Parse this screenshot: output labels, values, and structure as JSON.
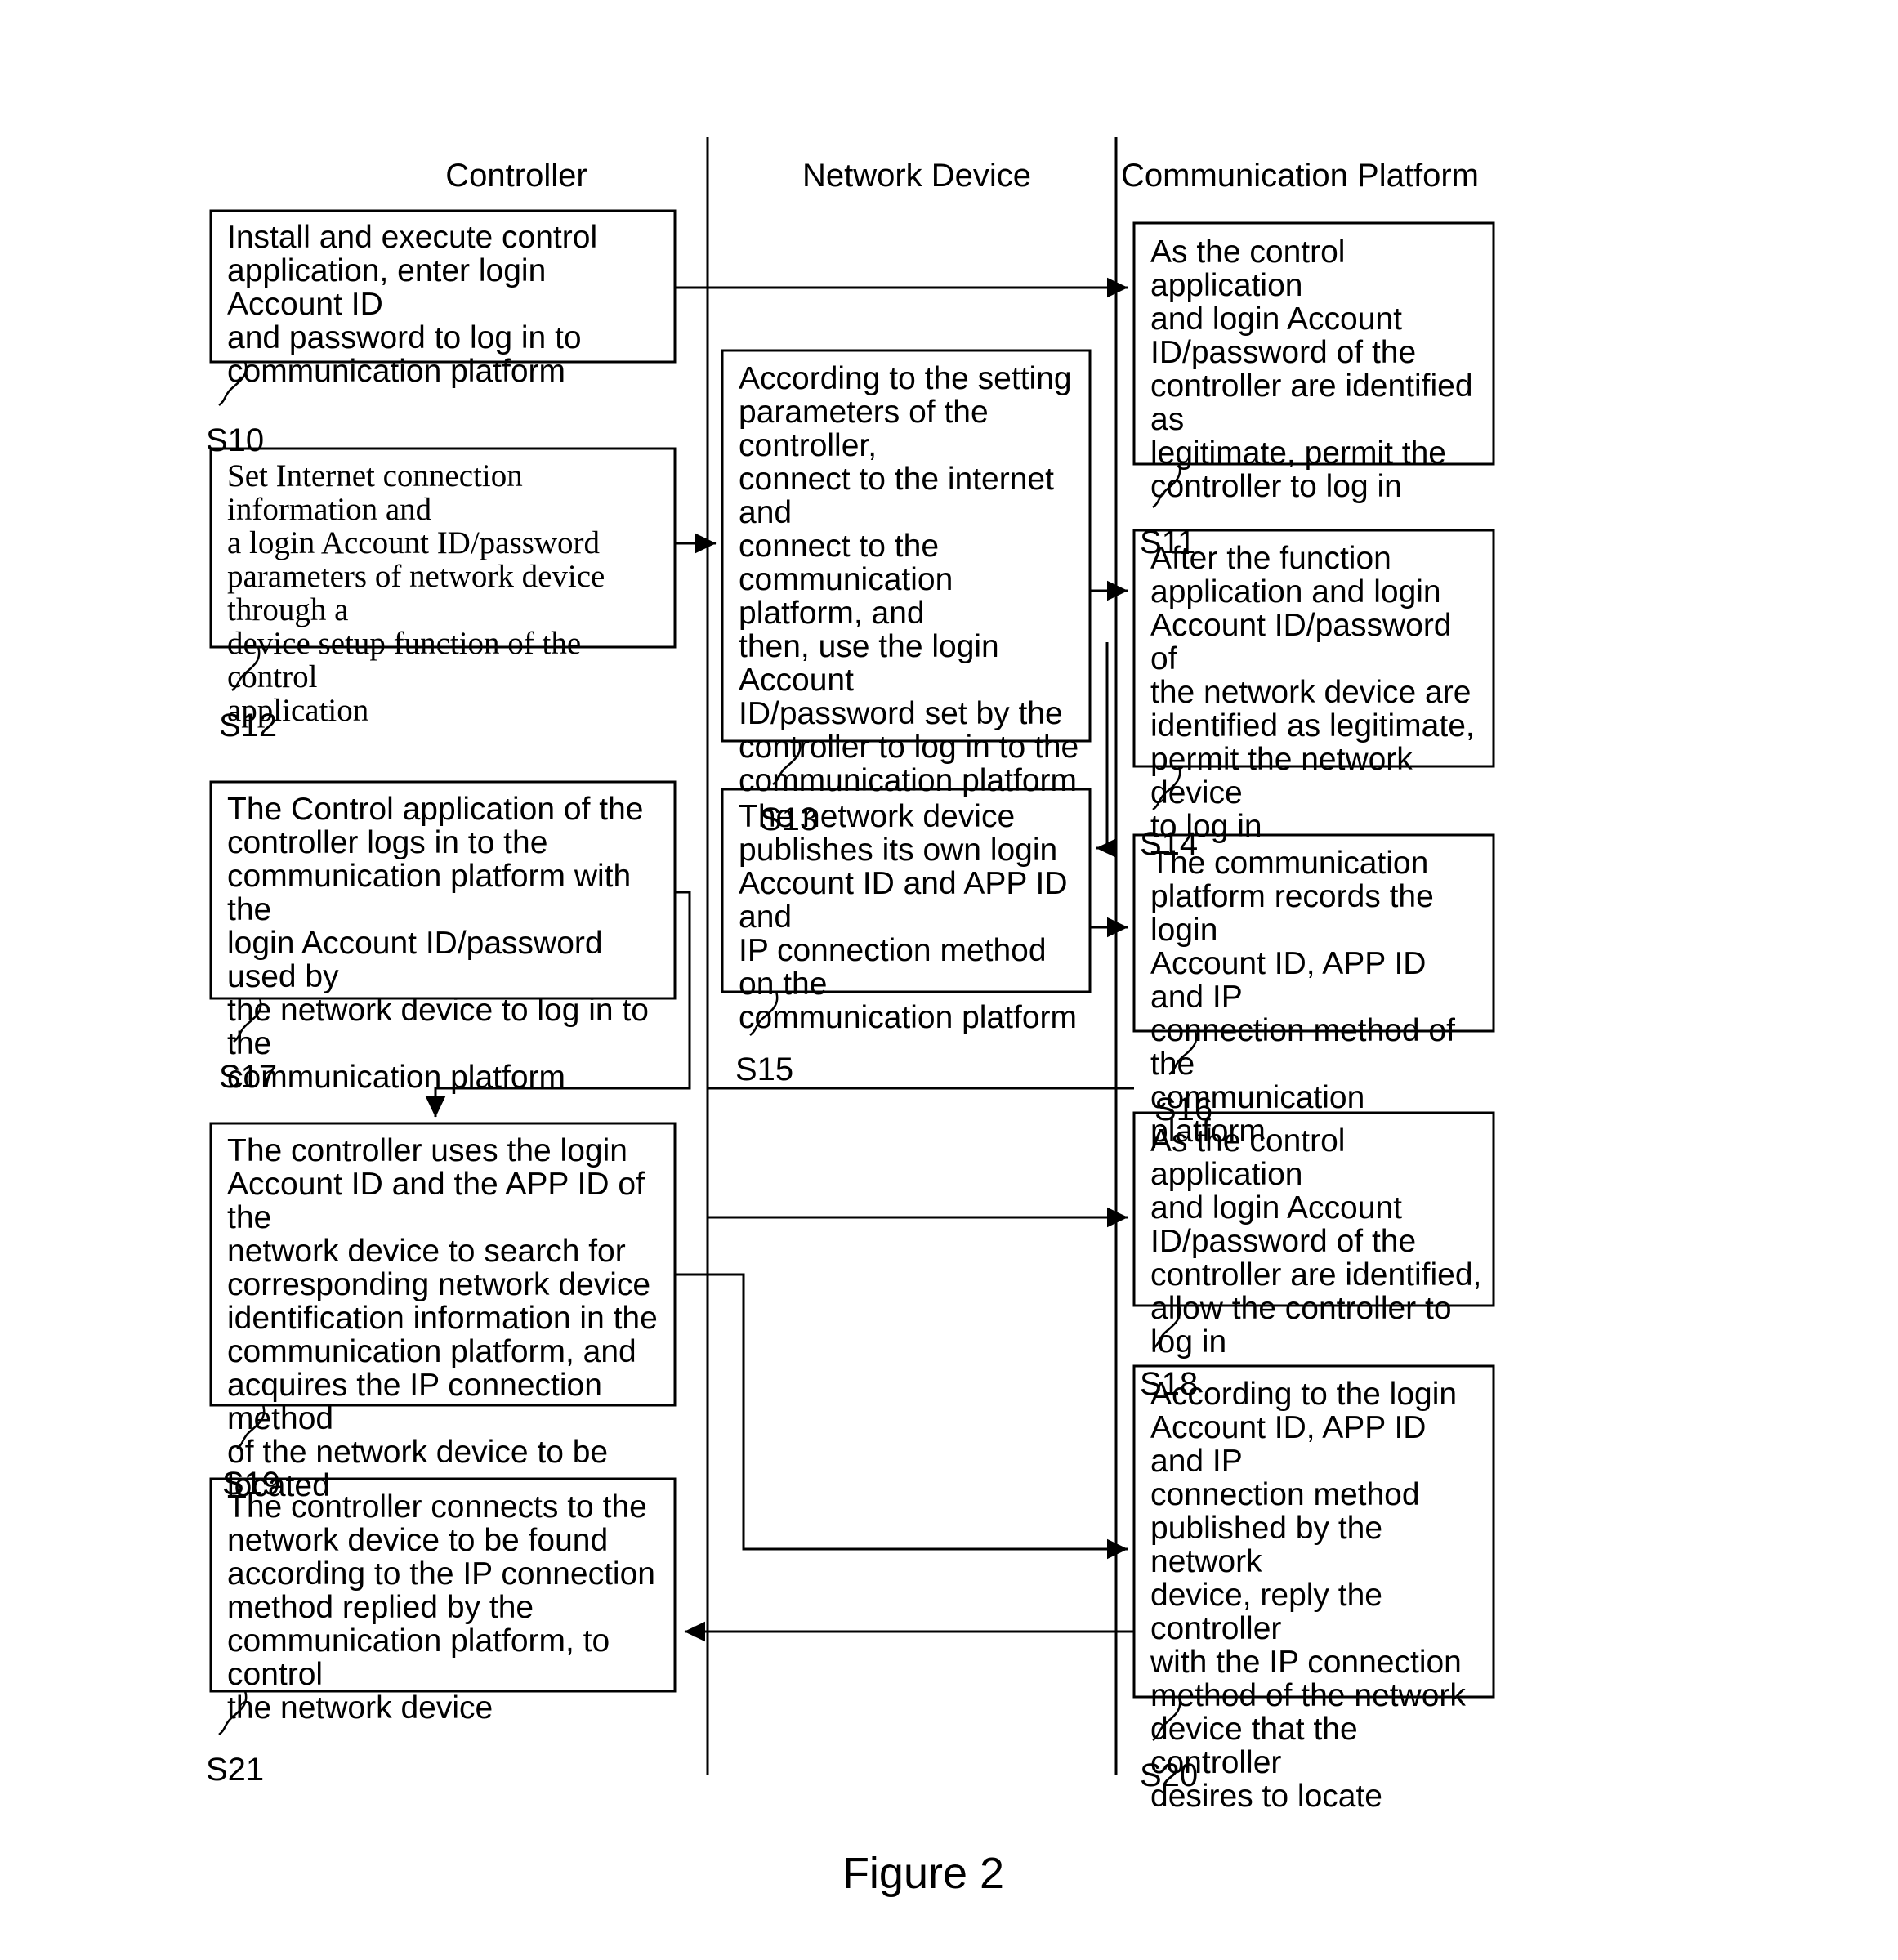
{
  "figure": {
    "caption": "Figure 2"
  },
  "lanes": [
    {
      "id": "controller",
      "title": "Controller"
    },
    {
      "id": "network-device",
      "title": "Network Device"
    },
    {
      "id": "communication-platform",
      "title": "Communication Platform"
    }
  ],
  "steps": [
    {
      "id": "S10",
      "lane": "controller",
      "label": "S10",
      "font": "sans",
      "text": "Install and execute control\napplication, enter login Account ID\nand password to log in to\ncommunication platform"
    },
    {
      "id": "S11",
      "lane": "communication-platform",
      "label": "S11",
      "font": "sans",
      "text": "As the control application\nand login Account\nID/password of the\ncontroller are identified as\nlegitimate, permit the\ncontroller to log in"
    },
    {
      "id": "S12",
      "lane": "controller",
      "label": "S12",
      "font": "serif",
      "text": "Set Internet connection information and\na login Account ID/password\nparameters of network device through a\ndevice setup function of the control\napplication"
    },
    {
      "id": "S13",
      "lane": "network-device",
      "label": "S13",
      "font": "sans",
      "text": "According to the setting\nparameters of the controller,\nconnect to the internet and\nconnect to the\ncommunication platform, and\nthen, use the login Account\nID/password set by the\ncontroller to log in to the\ncommunication platform"
    },
    {
      "id": "S14",
      "lane": "communication-platform",
      "label": "S14",
      "font": "sans",
      "text": "After the function\napplication and login\nAccount ID/password of\nthe network device are\nidentified as legitimate,\npermit the network device\nto log in"
    },
    {
      "id": "S15",
      "lane": "network-device",
      "label": "S15",
      "font": "sans",
      "text": "The network device\npublishes its own login\nAccount ID and APP ID and\nIP connection method on the\ncommunication platform"
    },
    {
      "id": "S16",
      "lane": "communication-platform",
      "label": "S16",
      "font": "sans",
      "text": "The communication\nplatform records the login\nAccount ID, APP ID and IP\nconnection method of the\ncommunication platform"
    },
    {
      "id": "S17",
      "lane": "controller",
      "label": "S17",
      "font": "sans",
      "text": "The Control application of the\ncontroller logs in to the\ncommunication platform with the\nlogin Account ID/password used by\nthe network device to log in to the\ncommunication platform"
    },
    {
      "id": "S18",
      "lane": "communication-platform",
      "label": "S18",
      "font": "sans",
      "text": "As the control application\nand login Account\nID/password of the\ncontroller are identified,\nallow the controller to log in"
    },
    {
      "id": "S19",
      "lane": "controller",
      "label": "S19",
      "font": "sans",
      "text": "The controller uses the login\nAccount ID and the APP ID of the\nnetwork device to search for\ncorresponding network device\nidentification information in the\ncommunication platform, and\nacquires the IP connection method\nof the network device to be located"
    },
    {
      "id": "S20",
      "lane": "communication-platform",
      "label": "S20",
      "font": "sans",
      "text": "According to the login\nAccount ID, APP ID and IP\nconnection method\npublished by the network\ndevice, reply the controller\nwith the IP connection\nmethod of the network\ndevice that the controller\ndesires to locate"
    },
    {
      "id": "S21",
      "lane": "controller",
      "label": "S21",
      "font": "sans",
      "text": "The controller connects to the\nnetwork device to be found\naccording to the IP connection\nmethod replied by the\ncommunication platform, to control\nthe network device"
    }
  ],
  "flows": [
    {
      "from": "S10",
      "to": "S11",
      "kind": "right"
    },
    {
      "from": "S12",
      "to": "S13",
      "kind": "right"
    },
    {
      "from": "S13",
      "to": "S14",
      "kind": "right"
    },
    {
      "from": "S14",
      "to": "S15",
      "kind": "left"
    },
    {
      "from": "S15",
      "to": "S16",
      "kind": "right"
    },
    {
      "from": "S17",
      "to": "S19",
      "kind": "down-left"
    },
    {
      "from": "S16",
      "to": "S18",
      "kind": "right"
    },
    {
      "from": "S19",
      "to": "S20",
      "kind": "right"
    },
    {
      "from": "S20",
      "to": "S21",
      "kind": "left"
    }
  ],
  "colors": {
    "stroke": "#000000",
    "fill": "#ffffff",
    "background": "#ffffff"
  }
}
